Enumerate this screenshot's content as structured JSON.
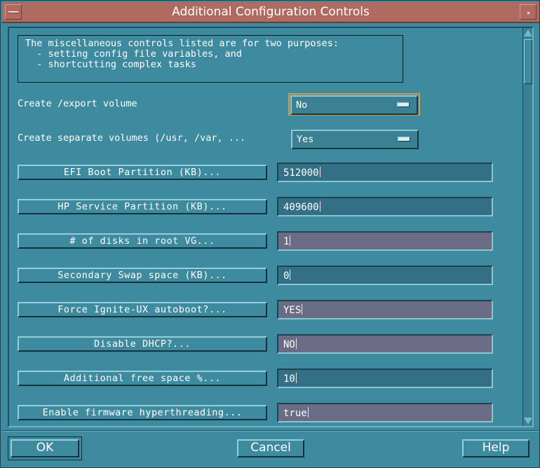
{
  "window": {
    "title": "Additional Configuration Controls"
  },
  "info": {
    "lines": [
      "The miscellaneous controls listed are for two purposes:",
      "  - setting config file variables, and",
      "  - shortcutting complex tasks"
    ]
  },
  "options": [
    {
      "label": "Create /export volume",
      "value": "No"
    },
    {
      "label": "Create separate volumes (/usr, /var, ...",
      "value": "Yes"
    }
  ],
  "fields": [
    {
      "button": "EFI Boot Partition (KB)...",
      "value": "512000"
    },
    {
      "button": "HP Service Partition (KB)...",
      "value": "409600"
    },
    {
      "button": "# of disks in root VG...",
      "value": "1"
    },
    {
      "button": "Secondary Swap space (KB)...",
      "value": "0"
    },
    {
      "button": "Force Ignite-UX autoboot?...",
      "value": "YES"
    },
    {
      "button": "Disable DHCP?...",
      "value": "NO"
    },
    {
      "button": "Additional free space %...",
      "value": "10"
    },
    {
      "button": "Enable firmware hyperthreading...",
      "value": "true"
    }
  ],
  "buttons": {
    "ok": "OK",
    "cancel": "Cancel",
    "help": "Help"
  },
  "colors": {
    "background": "#3e8ba0",
    "titlebar": "#b06b60",
    "focus": "#d39a4b"
  }
}
